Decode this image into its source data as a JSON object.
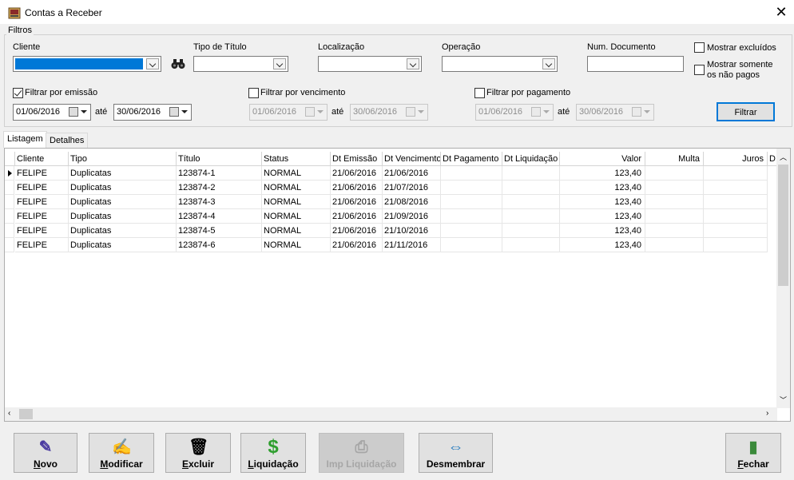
{
  "window": {
    "title": "Contas a Receber",
    "close_glyph": "✕"
  },
  "filters": {
    "group_label": "Filtros",
    "cliente_label": "Cliente",
    "tipo_titulo_label": "Tipo de Título",
    "localizacao_label": "Localização",
    "operacao_label": "Operação",
    "num_documento_label": "Num. Documento",
    "mostrar_excluidos_label": "Mostrar excluídos",
    "mostrar_nao_pagos_line1": "Mostrar somente",
    "mostrar_nao_pagos_line2": "os não pagos",
    "emissao": {
      "label": "Filtrar por emissão",
      "checked": true,
      "from": "01/06/2016",
      "to": "30/06/2016"
    },
    "vencimento": {
      "label": "Filtrar por vencimento",
      "checked": false,
      "from": "01/06/2016",
      "to": "30/06/2016"
    },
    "pagamento": {
      "label": "Filtrar por pagamento",
      "checked": false,
      "from": "01/06/2016",
      "to": "30/06/2016"
    },
    "ate_label": "até",
    "filtrar_button": "Filtrar",
    "search_icon": "binoculars-icon"
  },
  "tabs": [
    {
      "label": "Listagem",
      "active": true
    },
    {
      "label": "Detalhes",
      "active": false
    }
  ],
  "grid": {
    "columns": [
      "Cliente",
      "Tipo",
      "Título",
      "Status",
      "Dt Emissão",
      "Dt Vencimento",
      "Dt Pagamento",
      "Dt Liquidação",
      "Valor",
      "Multa",
      "Juros",
      "D"
    ],
    "rows": [
      [
        "FELIPE",
        "Duplicatas",
        "123874-1",
        "NORMAL",
        "21/06/2016",
        "21/06/2016",
        "",
        "",
        "123,40",
        "",
        ""
      ],
      [
        "FELIPE",
        "Duplicatas",
        "123874-2",
        "NORMAL",
        "21/06/2016",
        "21/07/2016",
        "",
        "",
        "123,40",
        "",
        ""
      ],
      [
        "FELIPE",
        "Duplicatas",
        "123874-3",
        "NORMAL",
        "21/06/2016",
        "21/08/2016",
        "",
        "",
        "123,40",
        "",
        ""
      ],
      [
        "FELIPE",
        "Duplicatas",
        "123874-4",
        "NORMAL",
        "21/06/2016",
        "21/09/2016",
        "",
        "",
        "123,40",
        "",
        ""
      ],
      [
        "FELIPE",
        "Duplicatas",
        "123874-5",
        "NORMAL",
        "21/06/2016",
        "21/10/2016",
        "",
        "",
        "123,40",
        "",
        ""
      ],
      [
        "FELIPE",
        "Duplicatas",
        "123874-6",
        "NORMAL",
        "21/06/2016",
        "21/11/2016",
        "",
        "",
        "123,40",
        "",
        ""
      ]
    ]
  },
  "buttons": [
    {
      "name": "novo",
      "label_u": "N",
      "label_rest": "ovo",
      "icon": "✎",
      "icon_name": "new-document-icon",
      "enabled": true
    },
    {
      "name": "modificar",
      "label_u": "M",
      "label_rest": "odificar",
      "icon": "✍",
      "icon_name": "edit-icon",
      "enabled": true
    },
    {
      "name": "excluir",
      "label_u": "E",
      "label_rest": "xcluir",
      "icon": "🗑",
      "icon_name": "trash-icon",
      "enabled": true
    },
    {
      "name": "liquidacao",
      "label_u": "L",
      "label_rest": "iquidação",
      "icon": "$",
      "icon_name": "dollar-icon",
      "enabled": true
    },
    {
      "name": "imp-liquidacao",
      "label_u": "",
      "label_rest": "Imp Liquidação",
      "icon": "⎙",
      "icon_name": "printer-icon",
      "enabled": false
    },
    {
      "name": "desmembrar",
      "label_u": "",
      "label_rest": "Desmembrar",
      "icon": "⇔",
      "icon_name": "split-icon",
      "enabled": true
    },
    {
      "name": "fechar",
      "label_u": "F",
      "label_rest": "echar",
      "icon": "▮",
      "icon_name": "door-exit-icon",
      "enabled": true
    }
  ],
  "colors": {
    "accent": "#0078d7",
    "dollar": "#2e9e2e",
    "split": "#1c75bc"
  }
}
